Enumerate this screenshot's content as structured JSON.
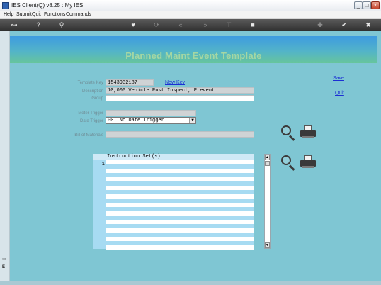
{
  "window": {
    "title": "IES Client(Q) v8.25 : My IES"
  },
  "window_controls": {
    "minimize": "_",
    "maximize": "□",
    "close": "×"
  },
  "menu": {
    "items": [
      "Help",
      "Submit",
      "Quit",
      "Functions",
      "Commands"
    ]
  },
  "toolbar": {
    "icons": [
      "key-icon",
      "help-icon",
      "search-icon",
      "heart-icon",
      "refresh-icon",
      "rewind-icon",
      "fast-forward-icon",
      "pin-icon",
      "square-icon",
      "plus-icon",
      "check-icon",
      "close-icon"
    ],
    "glyphs": {
      "key": "⊶",
      "help": "?",
      "search": "⚲",
      "heart": "♥",
      "refresh": "⟳",
      "rewind": "«",
      "fast_forward": "»",
      "pin": "⊤",
      "square": "■",
      "plus": "✚",
      "check": "✔",
      "close": "✖"
    }
  },
  "page": {
    "title": "Planned Maint Event Template",
    "save_label": "Save",
    "quit_label": "Quit"
  },
  "form": {
    "template_key_label": "Template Key",
    "template_key_value": "1543932187",
    "new_key_label": "New Key",
    "description_label": "Description",
    "description_value": "10,000 Vehicle Rust Inspect, Prevent",
    "group_label": "Group",
    "group_value": "",
    "meter_trigger_label": "Meter Trigger",
    "meter_trigger_value": "",
    "date_trigger_label": "Date Trigger",
    "date_trigger_value": "00: No Date Trigger",
    "bill_of_materials_label": "Bill of Materials",
    "bill_of_materials_value": ""
  },
  "instructions": {
    "header": "Instruction Set(s)",
    "first_row_number": "1"
  },
  "left_strip": {
    "mark_top": "▭",
    "mark_bottom": "E"
  },
  "colors": {
    "background": "#7fc6d3",
    "header_gradient_top": "#3e9be0",
    "header_gradient_bottom": "#67c59c",
    "title_text": "#a5d7a3",
    "link": "#1c2fd4"
  }
}
